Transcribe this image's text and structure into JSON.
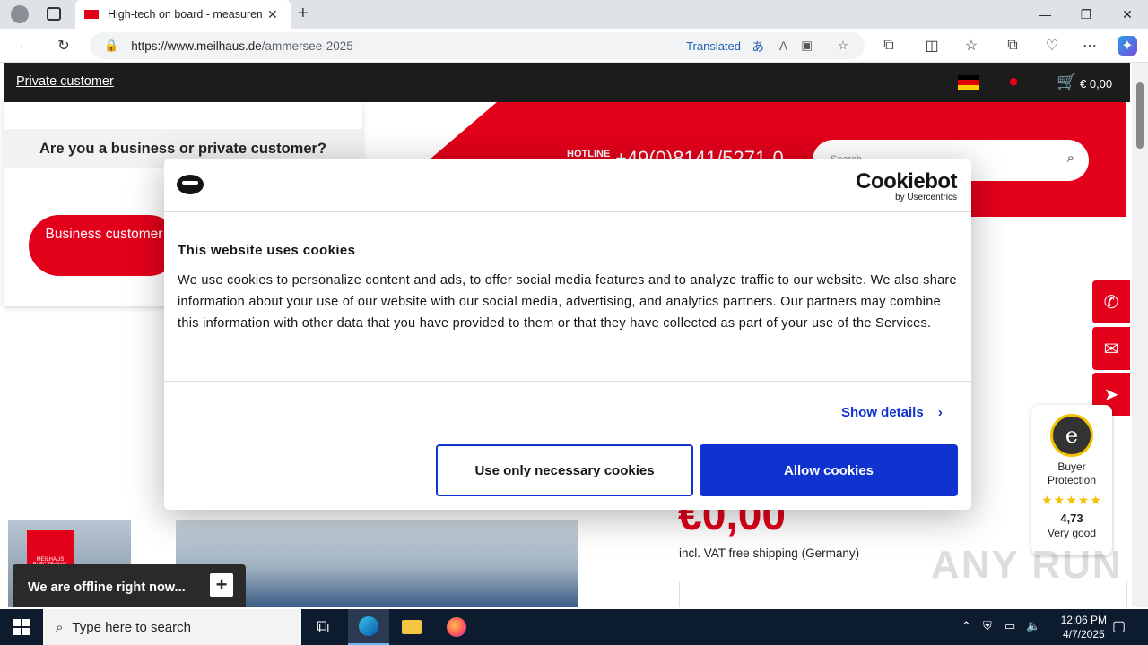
{
  "browser": {
    "tab_title": "High-tech on board - measurem",
    "url_host": "https://www.meilhaus.de",
    "url_path": "/ammersee-2025",
    "translated_label": "Translated"
  },
  "site": {
    "private_customer_link": "Private customer",
    "cart_total": "€ 0,00",
    "hotline_label": "HOTLINE",
    "hotline_number": "+49(0)8141/5271-0",
    "search_placeholder": "Search...",
    "customer_question": "Are you a business or private customer?",
    "business_button": "Business customer",
    "price": "€0,00",
    "vat_note": "incl. VAT free shipping (Germany)",
    "logo_text": "MEILHAUS ELECTRONIC",
    "offline_text": "We are offline right now...",
    "offline_plus": "+",
    "trust": {
      "label": "Buyer Protection",
      "stars": "★★★★★",
      "score": "4,73",
      "rating_text": "Very good",
      "seal_letter": "e"
    },
    "watermark": "ANY RUN"
  },
  "cookie": {
    "brand_name": "Cookiebot",
    "brand_by": "by Usercentrics",
    "title": "This website uses cookies",
    "body": "We use cookies to personalize content and ads, to offer social media features and to analyze traffic to our website. We also share information about your use of our website with our social media, advertising, and analytics partners. Our partners may combine this information with other data that you have provided to them or that they have collected as part of your use of the Services.",
    "show_details": "Show details",
    "necessary_button": "Use only necessary cookies",
    "allow_button": "Allow cookies"
  },
  "taskbar": {
    "search_placeholder": "Type here to search",
    "time": "12:06 PM",
    "date": "4/7/2025"
  },
  "colors": {
    "brand_red": "#e2001a",
    "cookie_blue": "#1032cf",
    "site_bar": "#1c1c1c"
  }
}
